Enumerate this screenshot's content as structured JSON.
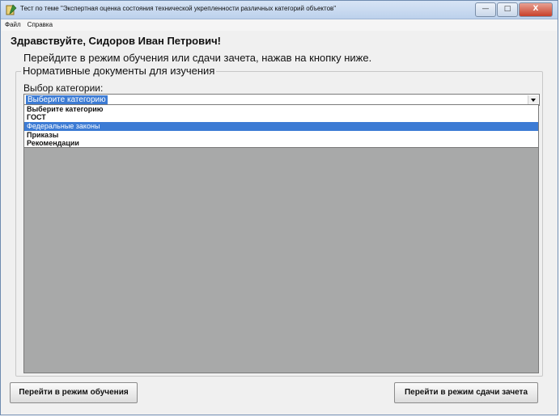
{
  "window": {
    "title": "Тест по теме \"Экспертная оценка  состояния технической укрепленности различных категорий объектов\"",
    "controls": {
      "minimize": "—",
      "maximize": "□",
      "close": "X"
    }
  },
  "menu": {
    "items": [
      {
        "label": "Файл"
      },
      {
        "label": "Справка"
      }
    ]
  },
  "greeting": "Здравствуйте, Сидоров Иван Петрович!",
  "hint": "Перейдите в режим обучения или сдачи зачета, нажав на кнопку ниже.",
  "group": {
    "legend": "Нормативные документы для изучения"
  },
  "category": {
    "label": "Выбор категории:",
    "selected": "Выберите категорию",
    "options": [
      {
        "label": "Выберите категорию",
        "selected": false
      },
      {
        "label": "ГОСТ",
        "selected": false
      },
      {
        "label": "Федеральные законы",
        "selected": true
      },
      {
        "label": "Приказы",
        "selected": false
      },
      {
        "label": "Рекомендации",
        "selected": false
      }
    ]
  },
  "buttons": {
    "learn": "Перейти в режим обучения",
    "exam": "Перейти в режим сдачи зачета"
  },
  "colors": {
    "selection": "#3c7bd4",
    "panel": "#a8a9a9"
  }
}
